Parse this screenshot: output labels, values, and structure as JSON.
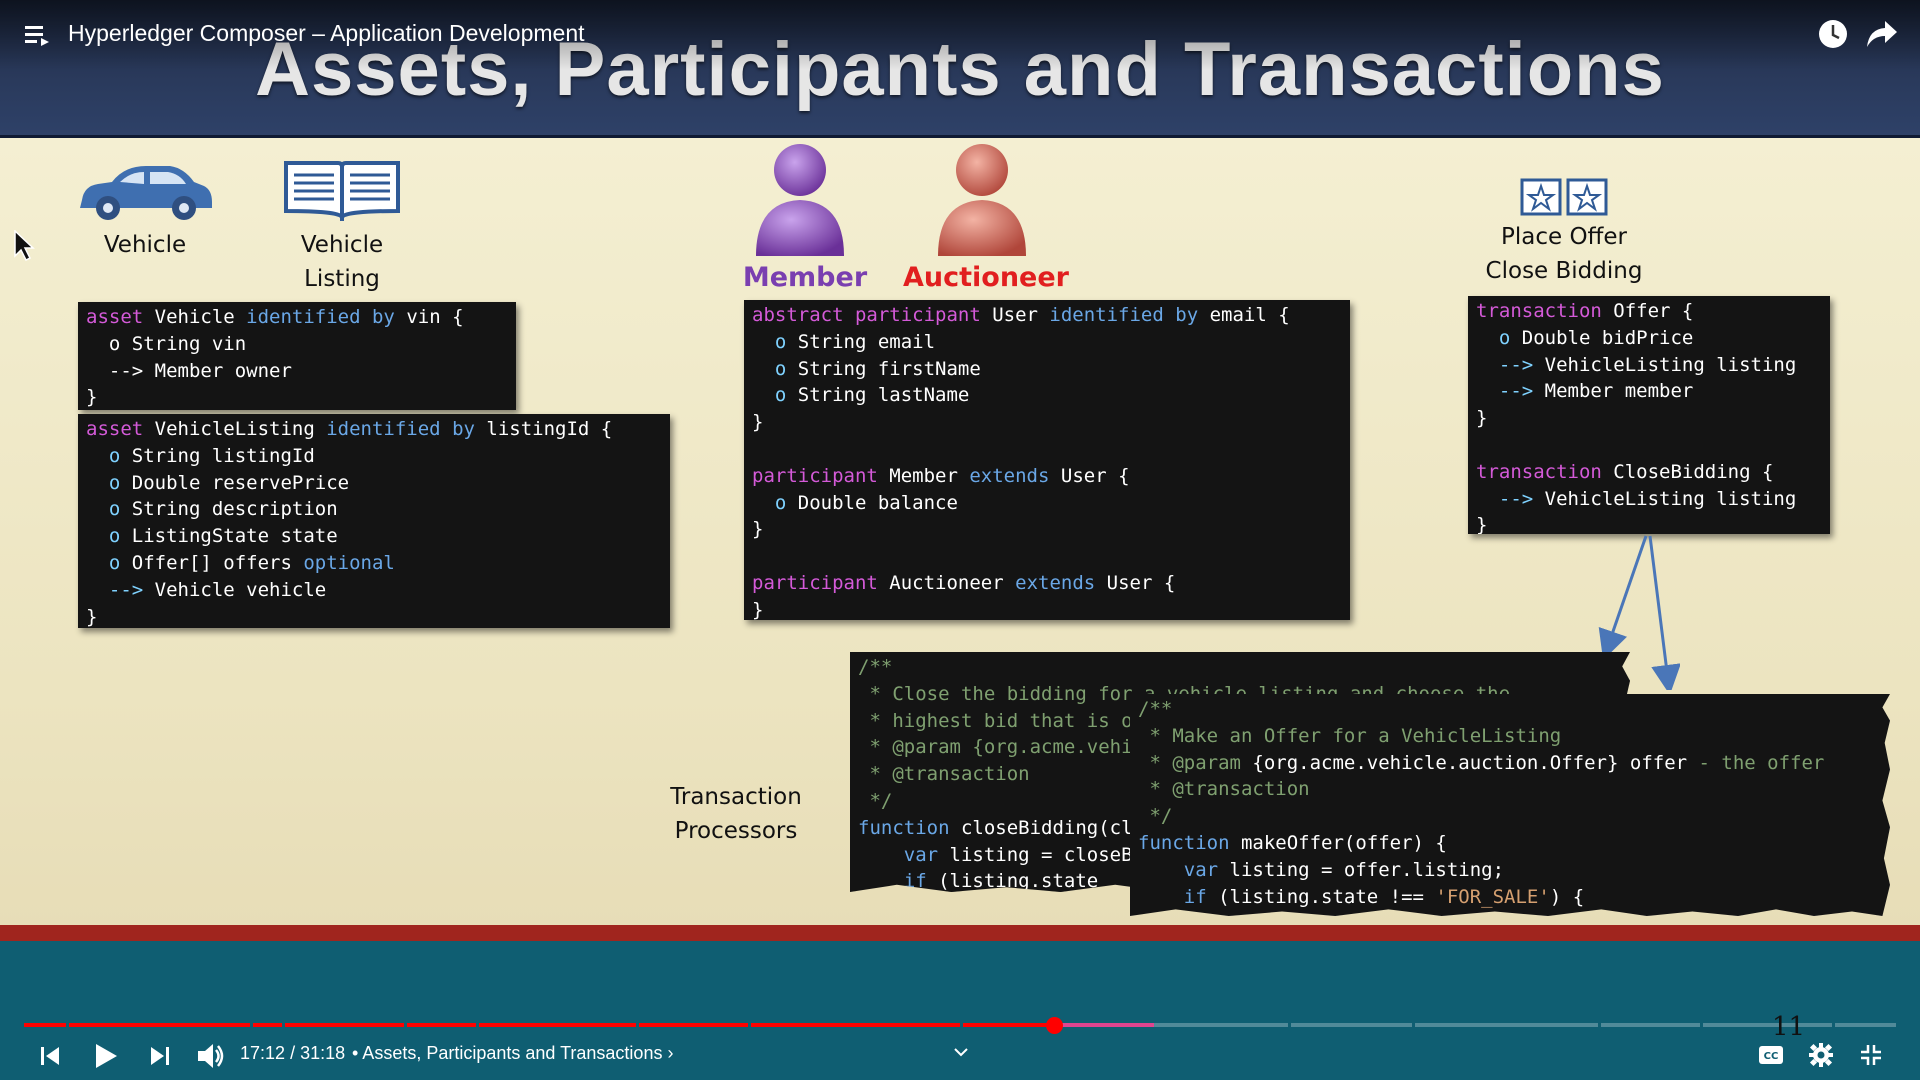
{
  "player": {
    "video_title": "Hyperledger Composer – Application Development",
    "time_current": "17:12",
    "time_total": "31:18",
    "time_separator": "/",
    "chapter": "• Assets, Participants and Transactions ›",
    "progress": 0.55,
    "icons": {
      "menu": "playlist-menu-icon",
      "watch_later": "clock-icon",
      "share": "share-arrow-icon",
      "prev": "previous-icon",
      "play": "play-icon",
      "next": "next-icon",
      "volume": "volume-icon",
      "chevron": "chevron-down-icon",
      "cc": "captions-icon",
      "settings": "gear-icon",
      "fullscreen": "exit-fullscreen-icon"
    },
    "colors": {
      "played": "#ff0000",
      "teal_band": "#0f5e72"
    }
  },
  "slide": {
    "title": "Assets, Participants and Transactions",
    "number": "11",
    "labels": {
      "vehicle": "Vehicle",
      "vehicle_listing_1": "Vehicle",
      "vehicle_listing_2": "Listing",
      "member": "Member",
      "auctioneer": "Auctioneer",
      "place_offer": "Place Offer",
      "close_bidding": "Close Bidding",
      "tp_1": "Transaction",
      "tp_2": "Processors"
    },
    "colors": {
      "member": "#7a3fb0",
      "auctioneer": "#e11f1f"
    },
    "code": {
      "vehicle": [
        [
          [
            "kw",
            "asset "
          ],
          [
            "id",
            "Vehicle "
          ],
          [
            "kw2",
            "identified by "
          ],
          [
            "id",
            "vin {"
          ]
        ],
        [
          [
            "id",
            "  o "
          ],
          [
            "id",
            "String vin"
          ]
        ],
        [
          [
            "id",
            "  --> Member owner"
          ]
        ],
        [
          [
            "id",
            "}"
          ]
        ]
      ],
      "listing": [
        [
          [
            "kw",
            "asset "
          ],
          [
            "id",
            "VehicleListing "
          ],
          [
            "kw2",
            "identified by "
          ],
          [
            "id",
            "listingId {"
          ]
        ],
        [
          [
            "tp",
            "  o "
          ],
          [
            "id",
            "String listingId"
          ]
        ],
        [
          [
            "tp",
            "  o "
          ],
          [
            "id",
            "Double reservePrice"
          ]
        ],
        [
          [
            "tp",
            "  o "
          ],
          [
            "id",
            "String description"
          ]
        ],
        [
          [
            "tp",
            "  o "
          ],
          [
            "id",
            "ListingState state"
          ]
        ],
        [
          [
            "tp",
            "  o "
          ],
          [
            "id",
            "Offer[] offers "
          ],
          [
            "kw2",
            "optional"
          ]
        ],
        [
          [
            "tp",
            "  --> "
          ],
          [
            "id",
            "Vehicle vehicle"
          ]
        ],
        [
          [
            "id",
            "}"
          ]
        ]
      ],
      "participants": [
        [
          [
            "kw",
            "abstract participant "
          ],
          [
            "id",
            "User "
          ],
          [
            "kw2",
            "identified by "
          ],
          [
            "id",
            "email {"
          ]
        ],
        [
          [
            "tp",
            "  o "
          ],
          [
            "id",
            "String email"
          ]
        ],
        [
          [
            "tp",
            "  o "
          ],
          [
            "id",
            "String firstName"
          ]
        ],
        [
          [
            "tp",
            "  o "
          ],
          [
            "id",
            "String lastName"
          ]
        ],
        [
          [
            "id",
            "}"
          ]
        ],
        [
          [
            "id",
            ""
          ]
        ],
        [
          [
            "kw",
            "participant "
          ],
          [
            "id",
            "Member "
          ],
          [
            "kw2",
            "extends "
          ],
          [
            "id",
            "User {"
          ]
        ],
        [
          [
            "tp",
            "  o "
          ],
          [
            "id",
            "Double balance"
          ]
        ],
        [
          [
            "id",
            "}"
          ]
        ],
        [
          [
            "id",
            ""
          ]
        ],
        [
          [
            "kw",
            "participant "
          ],
          [
            "id",
            "Auctioneer "
          ],
          [
            "kw2",
            "extends "
          ],
          [
            "id",
            "User {"
          ]
        ],
        [
          [
            "id",
            "}"
          ]
        ]
      ],
      "transactions": [
        [
          [
            "kw",
            "transaction "
          ],
          [
            "id",
            "Offer {"
          ]
        ],
        [
          [
            "tp",
            "  o "
          ],
          [
            "id",
            "Double bidPrice"
          ]
        ],
        [
          [
            "tp",
            "  --> "
          ],
          [
            "id",
            "VehicleListing listing"
          ]
        ],
        [
          [
            "tp",
            "  --> "
          ],
          [
            "id",
            "Member member"
          ]
        ],
        [
          [
            "id",
            "}"
          ]
        ],
        [
          [
            "id",
            ""
          ]
        ],
        [
          [
            "kw",
            "transaction "
          ],
          [
            "id",
            "CloseBidding {"
          ]
        ],
        [
          [
            "tp",
            "  --> "
          ],
          [
            "id",
            "VehicleListing listing"
          ]
        ],
        [
          [
            "id",
            "}"
          ]
        ]
      ],
      "close_bidding_fn": [
        [
          [
            "cm",
            "/**"
          ]
        ],
        [
          [
            "cm",
            " * Close the bidding for a vehicle listing and choose the"
          ]
        ],
        [
          [
            "cm",
            " * highest bid that is over the asking price"
          ]
        ],
        [
          [
            "cm",
            " * @param {org.acme.vehicle.auction.CloseBidding} closeBidding"
          ]
        ],
        [
          [
            "cm",
            " * @transaction"
          ]
        ],
        [
          [
            "cm",
            " */"
          ]
        ],
        [
          [
            "kw2",
            "function "
          ],
          [
            "id",
            "closeBidding(closeBidding) {"
          ]
        ],
        [
          [
            "kw2",
            "    var "
          ],
          [
            "id",
            "listing = closeBidding.listing;"
          ]
        ],
        [
          [
            "kw2",
            "    if "
          ],
          [
            "id",
            "(listing.state"
          ]
        ]
      ],
      "make_offer_fn": [
        [
          [
            "cm",
            "/**"
          ]
        ],
        [
          [
            "cm",
            " * Make an Offer for a VehicleListing"
          ]
        ],
        [
          [
            "cm",
            " * @param "
          ],
          [
            "id",
            "{org.acme.vehicle.auction.Offer} offer "
          ],
          [
            "cm",
            "- the offer"
          ]
        ],
        [
          [
            "cm",
            " * @transaction"
          ]
        ],
        [
          [
            "cm",
            " */"
          ]
        ],
        [
          [
            "kw2",
            "function "
          ],
          [
            "id",
            "makeOffer(offer) {"
          ]
        ],
        [
          [
            "kw2",
            "    var "
          ],
          [
            "id",
            "listing = offer.listing;"
          ]
        ],
        [
          [
            "kw2",
            "    if "
          ],
          [
            "id",
            "(listing.state !== "
          ],
          [
            "str",
            "'FOR_SALE'"
          ],
          [
            "id",
            ") {"
          ]
        ]
      ]
    }
  }
}
